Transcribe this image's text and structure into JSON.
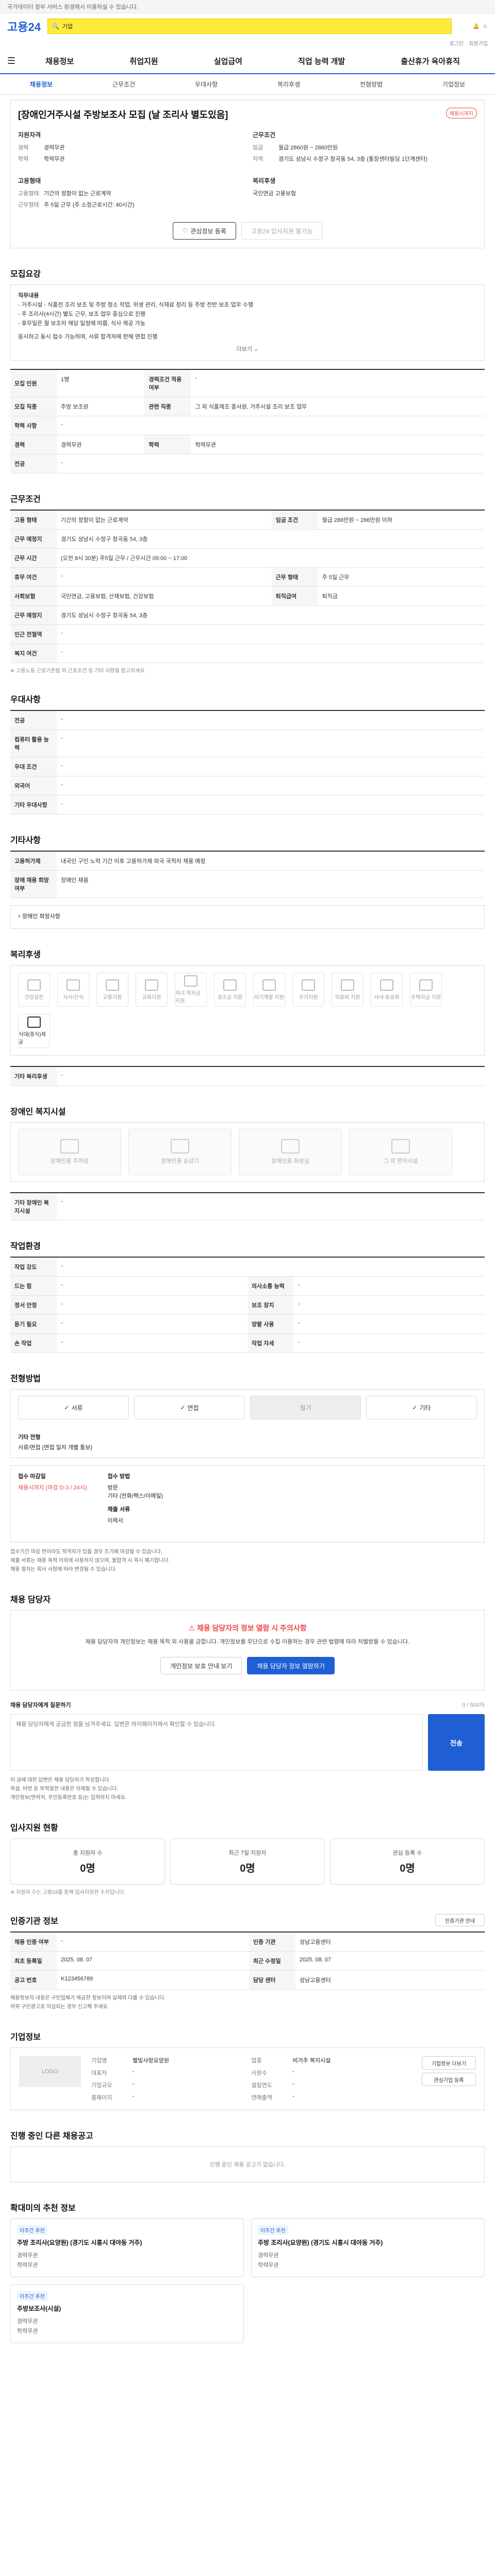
{
  "banner": {
    "text": "국가데이터 정부 서비스 환경에서 이용하실 수 있습니다."
  },
  "header": {
    "logo": "고용24",
    "search_placeholder": "기업",
    "util": [
      "로그인",
      "회원가입"
    ],
    "gnb": [
      "채용정보",
      "취업지원",
      "실업급여",
      "직업 능력 개발",
      "출산휴가 육아휴직"
    ]
  },
  "tabs": [
    "채용정보",
    "근무조건",
    "우대사항",
    "복리후생",
    "전형방법",
    "기업정보"
  ],
  "job": {
    "title": "[장애인거주시설 주방보조사 모집 (날 조리사 별도있음]",
    "badge": "채용시까지",
    "company_head": "지원자격",
    "conditions_head": "근무조건",
    "career_label": "경력",
    "career_value": "경력무관",
    "edu_label": "학력",
    "edu_value": "학력무관",
    "pay_label": "임금",
    "pay_value": "월급 2860원 ~ 2860만원",
    "region_label": "지역",
    "region_value": "경기도 성남시 수정구 창곡동 54, 3층 (통장센터빌딩 1단계센터)",
    "type_head": "고용형태",
    "type_label": "고용형태",
    "type_value": "기간의 정함이 없는 근로계약",
    "hours_label": "근무형태",
    "hours_value": "주 5일 근무 (주 소정근로시간: 40시간)",
    "manager_head": "복리후생",
    "manager_value": "국민연금 고용보험"
  },
  "actions": {
    "scrap": "관심정보 등록",
    "apply": "고용24 입사지원 불가능"
  },
  "recruit": {
    "section": "모집요강",
    "body": [
      "직무내용",
      "- 거주시설 - 식품전 조리 보조 및 주방 청소 작업, 위생 관리, 식재료 정리 등 주방 전반 보조 업무 수행",
      "- 주 조리사(4시간) 별도 근무, 보조 업무 중심으로 진행",
      "- 휴무일은 월 보조자 해당 일정에 따름, 식사 제공 가능",
      "응시하고 동시 접수 가능하며, 서류 합격자에 한해 면접 진행"
    ],
    "expand": "더보기"
  },
  "recruit_table": [
    {
      "k": "모집 인원",
      "v": "1명",
      "k2": "경력조건 적용 여부",
      "v2": "-"
    },
    {
      "k": "모집 직종",
      "v": "주방 보조원",
      "k2": "관련 직종",
      "v2": "그 외 식품제조 종사원, 거주시설 조리 보조 업무"
    },
    {
      "k": "학력 사항",
      "v": "-",
      "k2": "",
      "v2": ""
    },
    {
      "k": "경력",
      "v": "경력무관",
      "k2": "학력",
      "v2": "학력무관"
    },
    {
      "k": "전공",
      "v": "-",
      "k2": "",
      "v2": ""
    }
  ],
  "work": {
    "section": "근무조건",
    "rows": [
      {
        "k": "고용 형태",
        "v": "기간의 정함이 없는 근로계약",
        "k2": "임금 조건",
        "v2": "월급 286만원 ~ 286만원 이하"
      },
      {
        "k": "근무 예정지",
        "v": "경기도 성남시 수정구 창곡동 54, 3층",
        "k2": "",
        "v2": ""
      },
      {
        "k": "근무 시간",
        "v": "(오전 8시 30분) 주5일 근무 / 근무시간 09:00 ~ 17:00",
        "k2": "",
        "v2": ""
      },
      {
        "k": "휴무 여건",
        "v": "-",
        "k2": "근무 형태",
        "v2": "주 5일 근무"
      },
      {
        "k": "사회보험",
        "v": "국민연금, 고용보험, 산재보험, 건강보험",
        "k2": "퇴직급여",
        "v2": "퇴직금"
      },
      {
        "k": "근무 예정지",
        "v": "경기도 성남시 수정구 창곡동 54, 3층",
        "k2": "",
        "v2": ""
      },
      {
        "k": "인근 전철역",
        "v": "-",
        "k2": "",
        "v2": ""
      },
      {
        "k": "복지 여건",
        "v": "-",
        "k2": "",
        "v2": ""
      }
    ],
    "note": "※ 고용노동 근로기준법 외 근로조건 등 기타 사항을 참고하세요."
  },
  "pref": {
    "section": "우대사항",
    "rows": [
      {
        "k": "전공",
        "v": "-"
      },
      {
        "k": "컴퓨터 활용 능력",
        "v": "-"
      },
      {
        "k": "우대 조건",
        "v": "-"
      },
      {
        "k": "외국어",
        "v": "-"
      },
      {
        "k": "기타 우대사항",
        "v": "-"
      }
    ]
  },
  "etc": {
    "section": "기타사항",
    "rows": [
      {
        "k": "고용허가제",
        "v": "내국인 구인 노력 기간 이후 고용허가제 외국 국적자 채용 예정"
      },
      {
        "k": "장애 채용 희망 여부",
        "v": "장애인 채용"
      }
    ],
    "link": "장애인 희망사항"
  },
  "welfare": {
    "section": "복리후생",
    "items": [
      "건강검진",
      "식사/간식",
      "교통지원",
      "교육지원",
      "자녀 학자금 지원",
      "경조금 지원",
      "자기계발 지원",
      "주거지원",
      "의료비 지원",
      "사내 동호회",
      "주택자금 지원",
      "식대(중식)제공"
    ],
    "extra_label": "기타 복리후생",
    "extra_value": "-"
  },
  "disabled": {
    "section": "장애인 복지시설",
    "items": [
      "장애인용 주차장",
      "장애인용 승강기",
      "장애인용 화장실",
      "그 외 편의시설"
    ],
    "extra_label": "기타 장애인 복지시설",
    "extra_value": "-"
  },
  "env": {
    "section": "작업환경",
    "rows": [
      {
        "k": "작업 강도",
        "v": "-",
        "k2": "",
        "v2": ""
      },
      {
        "k": "드는 힘",
        "v": "-",
        "k2": "의사소통 능력",
        "v2": "-"
      },
      {
        "k": "정서 안정",
        "v": "-",
        "k2": "보조 장치",
        "v2": "-"
      },
      {
        "k": "듣기 필요",
        "v": "-",
        "k2": "양팔 사용",
        "v2": "-"
      },
      {
        "k": "손 작업",
        "v": "-",
        "k2": "작업 자세",
        "v2": "-"
      }
    ]
  },
  "process": {
    "section": "전형방법",
    "steps": [
      "서류",
      "면접",
      "필기",
      "기타"
    ],
    "extra_label": "기타 전형",
    "extra_value": "서류/면접 (면접 일자 개별 통보)",
    "period_label": "접수 마감일",
    "period_value": "채용시까지 (마감 D-3 / 24시)",
    "method_label": "접수 방법",
    "methods": [
      "방문",
      "기타 (전화/팩스/이메일)"
    ],
    "docs_label": "제출 서류",
    "docs_value": "이력서",
    "bullets": [
      "접수기간 마감 전이라도 적격자가 있을 경우 조기에 마감될 수 있습니다.",
      "제출 서류는 채용 목적 이외에 사용하지 않으며, 불합격 시 즉시 폐기합니다.",
      "채용 절차는 회사 사정에 따라 변경될 수 있습니다."
    ]
  },
  "contact": {
    "section": "채용 담당자",
    "notice_head": "채용 담당자의 정보 열람 시 주의사항",
    "notice_body": "채용 담당자의 개인정보는 채용 목적 외 사용을 금합니다. 개인정보를 무단으로 수집·이용하는 경우 관련 법령에 따라 처벌받을 수 있습니다.",
    "btn_view": "개인정보 보호 안내 보기",
    "btn_show": "채용 담당자 정보 열람하기",
    "inquiry_label": "채용 담당자에게 질문하기",
    "inquiry_counter": "0 / 500자",
    "inquiry_placeholder": "채용 담당자에게 궁금한 점을 남겨주세요. 답변은 마이페이지에서 확인할 수 있습니다.",
    "inquiry_send": "전송",
    "bullets": [
      "이 글에 대한 답변은 채용 담당자가 작성합니다.",
      "욕설, 비방 등 부적절한 내용은 삭제될 수 있습니다.",
      "개인정보(연락처, 주민등록번호 등)는 입력하지 마세요."
    ]
  },
  "stats": {
    "section": "입사지원 현황",
    "cards": [
      {
        "cap": "총 지원자 수",
        "num": "0명"
      },
      {
        "cap": "최근 7일 지원자",
        "num": "0명"
      },
      {
        "cap": "관심 등록 수",
        "num": "0명"
      }
    ],
    "note": "※ 지원자 수는 고용24를 통해 입사지원한 수치입니다."
  },
  "agency": {
    "section": "인증기관 정보",
    "btn": "인증기관 안내",
    "rows": [
      {
        "k": "채용 인증 여부",
        "v": "-",
        "k2": "인증 기관",
        "v2": "성남고용센터"
      },
      {
        "k": "최초 등록일",
        "v": "2025. 08. 07",
        "k2": "최근 수정일",
        "v2": "2025. 08. 07"
      },
      {
        "k": "공고 번호",
        "v": "K123456789",
        "k2": "담당 센터",
        "v2": "성남고용센터"
      }
    ],
    "bullets": [
      "채용정보의 내용은 구인업체가 제공한 정보이며 실제와 다를 수 있습니다.",
      "허위 구인광고로 의심되는 경우 신고해 주세요."
    ]
  },
  "company": {
    "section": "기업정보",
    "logo": "LOGO",
    "rows": [
      {
        "k": "기업명",
        "v": "별빛사랑요양원",
        "k2": "업종",
        "v2": "비거주 복지시설"
      },
      {
        "k": "대표자",
        "v": "-",
        "k2": "사원수",
        "v2": "-"
      },
      {
        "k": "기업규모",
        "v": "-",
        "k2": "설립연도",
        "v2": "-"
      },
      {
        "k": "홈페이지",
        "v": "-",
        "k2": "연매출액",
        "v2": "-"
      }
    ],
    "btn1": "기업정보 더보기",
    "btn2": "관심기업 등록"
  },
  "ongoing": {
    "section": "진행 중인 다른 채용공고",
    "empty": "진행 중인 채용 공고가 없습니다."
  },
  "related": {
    "section": "확대미의 추천 정보",
    "cards": [
      {
        "tag": "이주간 추천",
        "title": "주방 조리사(요양원) (경기도 시흥시 대야동 거주)",
        "rows": [
          "경력무관",
          "학력무관"
        ]
      },
      {
        "tag": "이주간 추천",
        "title": "주방 조리사(요양원) (경기도 시흥시 대야동 거주)",
        "rows": [
          "경력무관",
          "학력무관"
        ]
      },
      {
        "tag": "이주간 추천",
        "title": "주방보조사(시설)",
        "rows": [
          "경력무관",
          "학력무관"
        ]
      }
    ]
  }
}
